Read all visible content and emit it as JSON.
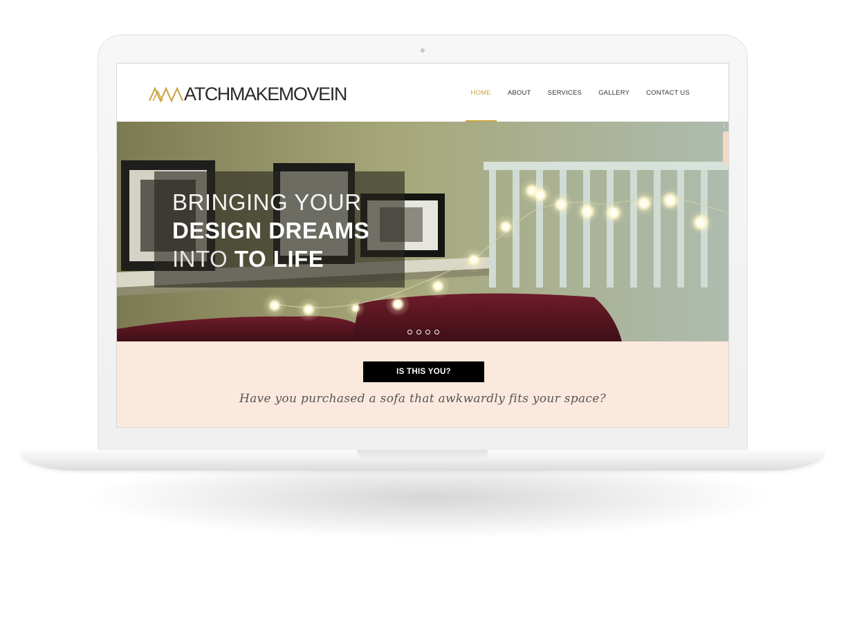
{
  "site": {
    "logo_text": "ATCHMAKEMOVEIN",
    "nav": [
      {
        "label": "HOME",
        "active": true
      },
      {
        "label": "ABOUT",
        "active": false
      },
      {
        "label": "SERVICES",
        "active": false
      },
      {
        "label": "GALLERY",
        "active": false
      },
      {
        "label": "CONTACT US",
        "active": false
      }
    ]
  },
  "hero": {
    "line1": "BRINGING YOUR",
    "line2": "DESIGN DREAMS",
    "line3_light": "INTO",
    "line3_bold": "TO LIFE",
    "next_arrow": "›"
  },
  "cta": {
    "button_label": "IS THIS YOU?",
    "tagline": "Have you purchased a sofa that awkwardly fits your space?"
  },
  "colors": {
    "accent": "#c9a23a",
    "cta_background": "#fce9dd",
    "button_background": "#000000"
  }
}
